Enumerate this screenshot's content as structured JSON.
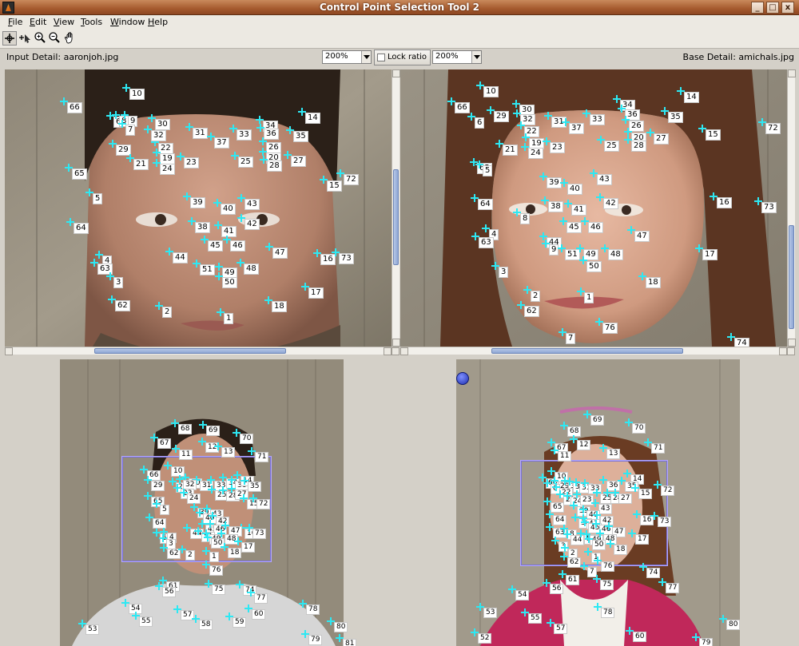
{
  "window": {
    "title": "Control Point Selection Tool 2",
    "minimize": "_",
    "maximize": "□",
    "close": "x"
  },
  "menu": [
    "File",
    "Edit",
    "View",
    "Tools",
    "Window",
    "Help"
  ],
  "toolbar": [
    "add-point-icon",
    "select-point-icon",
    "zoom-in-icon",
    "zoom-out-icon",
    "pan-hand-icon"
  ],
  "detail_bar": {
    "input_label": "Input Detail: aaronjoh.jpg",
    "input_zoom": "200%",
    "lock_ratio": "Lock ratio",
    "base_zoom": "200%",
    "base_label": "Base Detail: amichals.jpg"
  },
  "colors": {
    "point": "#2de8f3",
    "view_rect": "#7a72d8",
    "title_bar": "#a55a2e"
  },
  "points": {
    "input_detail": [
      [
        "66",
        80,
        127
      ],
      [
        "10",
        158,
        110
      ],
      [
        "6",
        138,
        145
      ],
      [
        "8",
        145,
        144
      ],
      [
        "9",
        156,
        144
      ],
      [
        "7",
        153,
        155
      ],
      [
        "30",
        190,
        148
      ],
      [
        "31",
        237,
        159
      ],
      [
        "37",
        264,
        171
      ],
      [
        "33",
        292,
        161
      ],
      [
        "34",
        325,
        150
      ],
      [
        "36",
        326,
        160
      ],
      [
        "35",
        363,
        163
      ],
      [
        "14",
        378,
        140
      ],
      [
        "29",
        141,
        180
      ],
      [
        "22",
        194,
        178
      ],
      [
        "32",
        185,
        162
      ],
      [
        "19",
        196,
        191
      ],
      [
        "24",
        196,
        204
      ],
      [
        "21",
        163,
        198
      ],
      [
        "23",
        226,
        196
      ],
      [
        "26",
        329,
        177
      ],
      [
        "20",
        329,
        190
      ],
      [
        "28",
        330,
        200
      ],
      [
        "25",
        294,
        195
      ],
      [
        "27",
        360,
        194
      ],
      [
        "65",
        86,
        210
      ],
      [
        "72",
        426,
        217
      ],
      [
        "15",
        405,
        225
      ],
      [
        "5",
        112,
        241
      ],
      [
        "39",
        234,
        246
      ],
      [
        "40",
        272,
        254
      ],
      [
        "43",
        302,
        248
      ],
      [
        "64",
        88,
        278
      ],
      [
        "38",
        240,
        277
      ],
      [
        "41",
        273,
        282
      ],
      [
        "42",
        302,
        273
      ],
      [
        "45",
        256,
        300
      ],
      [
        "46",
        284,
        300
      ],
      [
        "44",
        212,
        315
      ],
      [
        "47",
        337,
        309
      ],
      [
        "16",
        397,
        317
      ],
      [
        "73",
        420,
        316
      ],
      [
        "4",
        124,
        319
      ],
      [
        "63",
        118,
        329
      ],
      [
        "3",
        138,
        346
      ],
      [
        "51",
        246,
        330
      ],
      [
        "49",
        274,
        334
      ],
      [
        "50",
        274,
        346
      ],
      [
        "48",
        301,
        329
      ],
      [
        "17",
        382,
        359
      ],
      [
        "62",
        140,
        375
      ],
      [
        "18",
        336,
        376
      ],
      [
        "2",
        199,
        383
      ],
      [
        "1",
        276,
        391
      ]
    ],
    "base_detail": [
      [
        "10",
        601,
        107
      ],
      [
        "66",
        565,
        127
      ],
      [
        "29",
        614,
        138
      ],
      [
        "30",
        646,
        130
      ],
      [
        "34",
        772,
        124
      ],
      [
        "14",
        852,
        114
      ],
      [
        "6",
        590,
        146
      ],
      [
        "32",
        647,
        142
      ],
      [
        "31",
        686,
        145
      ],
      [
        "37",
        708,
        153
      ],
      [
        "33",
        734,
        142
      ],
      [
        "36",
        778,
        136
      ],
      [
        "35",
        832,
        139
      ],
      [
        "15",
        879,
        161
      ],
      [
        "72",
        954,
        153
      ],
      [
        "22",
        652,
        157
      ],
      [
        "26",
        783,
        150
      ],
      [
        "20",
        786,
        165
      ],
      [
        "28",
        786,
        175
      ],
      [
        "19",
        658,
        172
      ],
      [
        "27",
        814,
        166
      ],
      [
        "25",
        752,
        175
      ],
      [
        "21",
        625,
        180
      ],
      [
        "24",
        657,
        184
      ],
      [
        "23",
        684,
        177
      ],
      [
        "65",
        593,
        203
      ],
      [
        "5",
        600,
        206
      ],
      [
        "43",
        743,
        217
      ],
      [
        "39",
        680,
        221
      ],
      [
        "40",
        706,
        229
      ],
      [
        "64",
        594,
        248
      ],
      [
        "38",
        682,
        251
      ],
      [
        "41",
        711,
        255
      ],
      [
        "42",
        751,
        247
      ],
      [
        "16",
        893,
        246
      ],
      [
        "73",
        949,
        252
      ],
      [
        "8",
        647,
        266
      ],
      [
        "45",
        705,
        277
      ],
      [
        "46",
        732,
        277
      ],
      [
        "47",
        790,
        288
      ],
      [
        "4",
        608,
        286
      ],
      [
        "63",
        595,
        296
      ],
      [
        "44",
        680,
        296
      ],
      [
        "9",
        683,
        305
      ],
      [
        "51",
        703,
        311
      ],
      [
        "49",
        726,
        311
      ],
      [
        "48",
        757,
        311
      ],
      [
        "17",
        875,
        311
      ],
      [
        "50",
        730,
        326
      ],
      [
        "3",
        620,
        333
      ],
      [
        "18",
        804,
        346
      ],
      [
        "2",
        660,
        363
      ],
      [
        "1",
        727,
        365
      ],
      [
        "62",
        652,
        382
      ],
      [
        "76",
        750,
        403
      ],
      [
        "7",
        704,
        416
      ],
      [
        "74",
        915,
        422
      ]
    ],
    "input_overview": [
      [
        "68",
        219,
        530
      ],
      [
        "69",
        254,
        532
      ],
      [
        "70",
        296,
        542
      ],
      [
        "67",
        193,
        548
      ],
      [
        "12",
        253,
        553
      ],
      [
        "13",
        273,
        559
      ],
      [
        "11",
        220,
        562
      ],
      [
        "71",
        315,
        565
      ],
      [
        "66",
        180,
        588
      ],
      [
        "10",
        210,
        583
      ],
      [
        "30",
        232,
        598
      ],
      [
        "31",
        246,
        601
      ],
      [
        "33",
        264,
        601
      ],
      [
        "34",
        279,
        598
      ],
      [
        "36",
        290,
        601
      ],
      [
        "14",
        297,
        595
      ],
      [
        "29",
        185,
        601
      ],
      [
        "22",
        216,
        603
      ],
      [
        "32",
        225,
        600
      ],
      [
        "35",
        306,
        602
      ],
      [
        "23",
        222,
        611
      ],
      [
        "24",
        230,
        617
      ],
      [
        "25",
        265,
        613
      ],
      [
        "28",
        279,
        614
      ],
      [
        "27",
        290,
        612
      ],
      [
        "65",
        185,
        621
      ],
      [
        "15",
        305,
        624
      ],
      [
        "72",
        317,
        624
      ],
      [
        "5",
        196,
        631
      ],
      [
        "39",
        243,
        635
      ],
      [
        "43",
        259,
        637
      ],
      [
        "40",
        250,
        642
      ],
      [
        "64",
        187,
        648
      ],
      [
        "42",
        266,
        646
      ],
      [
        "44",
        234,
        661
      ],
      [
        "45",
        253,
        656
      ],
      [
        "46",
        263,
        656
      ],
      [
        "16",
        302,
        661
      ],
      [
        "73",
        312,
        661
      ],
      [
        "47",
        282,
        658
      ],
      [
        "63",
        196,
        667
      ],
      [
        "4",
        205,
        666
      ],
      [
        "51",
        248,
        665
      ],
      [
        "49",
        258,
        668
      ],
      [
        "48",
        277,
        668
      ],
      [
        "50",
        260,
        673
      ],
      [
        "3",
        204,
        674
      ],
      [
        "17",
        298,
        678
      ],
      [
        "62",
        205,
        686
      ],
      [
        "2",
        228,
        688
      ],
      [
        "18",
        281,
        685
      ],
      [
        "1",
        258,
        690
      ],
      [
        "76",
        258,
        707
      ],
      [
        "61",
        204,
        727
      ],
      [
        "56",
        199,
        734
      ],
      [
        "75",
        261,
        731
      ],
      [
        "74",
        300,
        732
      ],
      [
        "77",
        314,
        742
      ],
      [
        "54",
        157,
        755
      ],
      [
        "55",
        170,
        771
      ],
      [
        "57",
        222,
        763
      ],
      [
        "58",
        245,
        775
      ],
      [
        "59",
        287,
        772
      ],
      [
        "60",
        311,
        762
      ],
      [
        "78",
        379,
        756
      ],
      [
        "53",
        103,
        781
      ],
      [
        "79",
        382,
        794
      ],
      [
        "80",
        414,
        778
      ],
      [
        "81",
        425,
        799
      ]
    ],
    "base_overview": [
      [
        "69",
        735,
        519
      ],
      [
        "70",
        787,
        529
      ],
      [
        "68",
        706,
        533
      ],
      [
        "12",
        718,
        550
      ],
      [
        "67",
        690,
        554
      ],
      [
        "11",
        694,
        564
      ],
      [
        "13",
        755,
        561
      ],
      [
        "71",
        811,
        554
      ],
      [
        "66",
        679,
        598
      ],
      [
        "10",
        690,
        590
      ],
      [
        "29",
        694,
        602
      ],
      [
        "30",
        707,
        602
      ],
      [
        "32",
        713,
        603
      ],
      [
        "31",
        721,
        604
      ],
      [
        "33",
        732,
        605
      ],
      [
        "36",
        755,
        601
      ],
      [
        "14",
        785,
        593
      ],
      [
        "35",
        778,
        602
      ],
      [
        "6",
        685,
        605
      ],
      [
        "22",
        696,
        610
      ],
      [
        "21",
        701,
        619
      ],
      [
        "24",
        710,
        621
      ],
      [
        "23",
        722,
        619
      ],
      [
        "25",
        747,
        617
      ],
      [
        "28",
        760,
        617
      ],
      [
        "27",
        770,
        617
      ],
      [
        "15",
        795,
        611
      ],
      [
        "72",
        823,
        607
      ],
      [
        "65",
        685,
        628
      ],
      [
        "39",
        718,
        633
      ],
      [
        "43",
        745,
        630
      ],
      [
        "40",
        730,
        638
      ],
      [
        "64",
        688,
        644
      ],
      [
        "38",
        720,
        648
      ],
      [
        "41",
        730,
        649
      ],
      [
        "42",
        747,
        645
      ],
      [
        "16",
        797,
        644
      ],
      [
        "73",
        819,
        646
      ],
      [
        "63",
        688,
        660
      ],
      [
        "8",
        706,
        662
      ],
      [
        "45",
        732,
        654
      ],
      [
        "46",
        746,
        656
      ],
      [
        "47",
        762,
        659
      ],
      [
        "44",
        710,
        669
      ],
      [
        "51",
        727,
        668
      ],
      [
        "49",
        734,
        669
      ],
      [
        "48",
        751,
        668
      ],
      [
        "50",
        737,
        675
      ],
      [
        "17",
        791,
        668
      ],
      [
        "3",
        695,
        677
      ],
      [
        "18",
        764,
        681
      ],
      [
        "2",
        707,
        686
      ],
      [
        "62",
        706,
        697
      ],
      [
        "1",
        736,
        691
      ],
      [
        "7",
        731,
        709
      ],
      [
        "76",
        748,
        702
      ],
      [
        "74",
        805,
        710
      ],
      [
        "61",
        704,
        719
      ],
      [
        "56",
        684,
        730
      ],
      [
        "75",
        747,
        725
      ],
      [
        "77",
        829,
        729
      ],
      [
        "54",
        641,
        738
      ],
      [
        "53",
        601,
        760
      ],
      [
        "55",
        657,
        767
      ],
      [
        "57",
        689,
        780
      ],
      [
        "78",
        748,
        760
      ],
      [
        "52",
        594,
        792
      ],
      [
        "60",
        788,
        790
      ],
      [
        "80",
        905,
        775
      ],
      [
        "79",
        871,
        798
      ]
    ]
  }
}
